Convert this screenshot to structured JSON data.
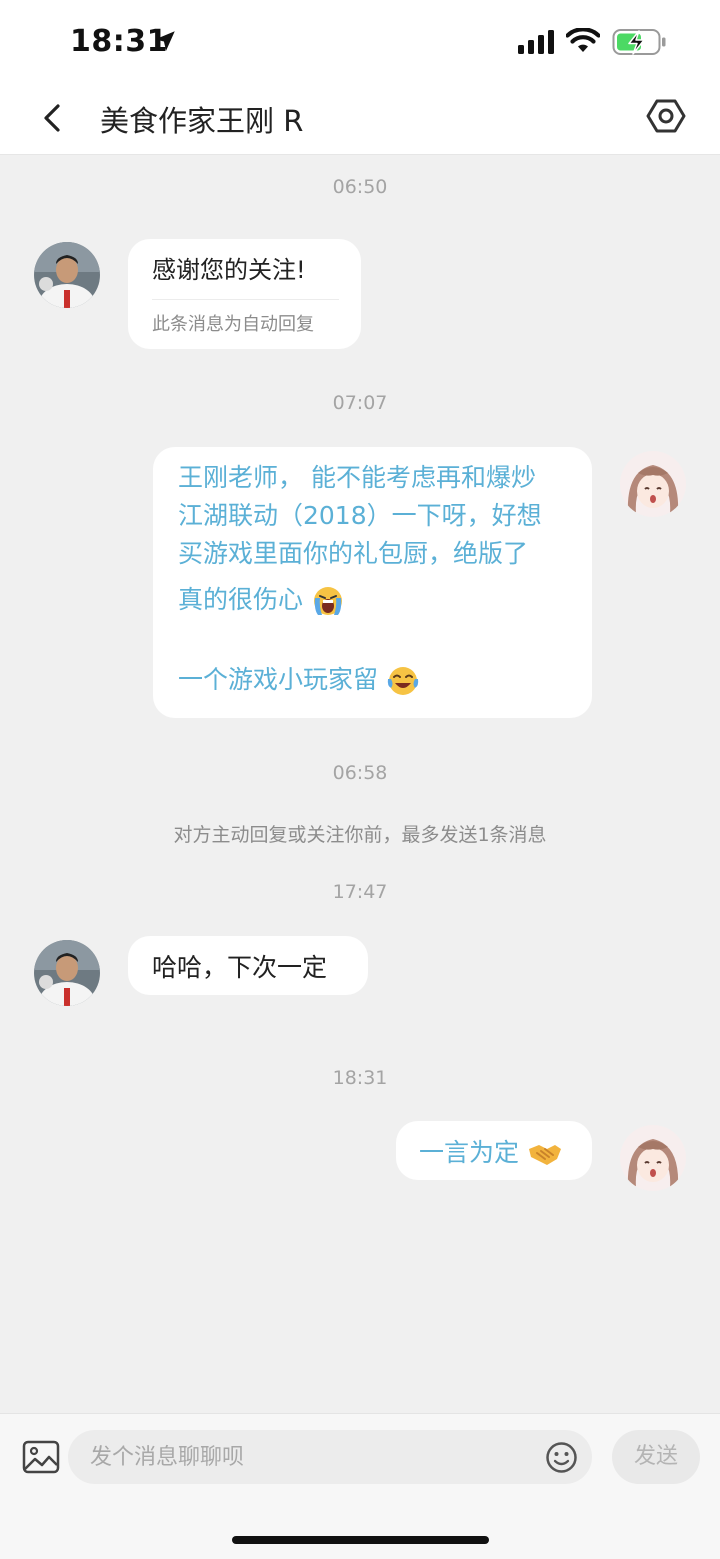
{
  "status": {
    "time": "18:31"
  },
  "nav": {
    "title": "美食作家王刚 R"
  },
  "messages": {
    "t1": "06:50",
    "m1_text": "感谢您的关注!",
    "m1_sub": "此条消息为自动回复",
    "t2": "07:07",
    "m2_line1": "王刚老师， 能不能考虑再和爆炒",
    "m2_line2": "江湖联动（2018）一下呀，好想",
    "m2_line3": "买游戏里面你的礼包厨，绝版了",
    "m2_line4": "真的很伤心",
    "m2_line6": "一个游戏小玩家留",
    "t3": "06:58",
    "notice": "对方主动回复或关注你前，最多发送1条消息",
    "t4": "17:47",
    "m3_text": "哈哈，下次一定",
    "t5": "18:31",
    "m4_text": "一言为定"
  },
  "composer": {
    "placeholder": "发个消息聊聊呗",
    "send_label": "发送"
  },
  "colors": {
    "my_text": "#5bb0d6",
    "background": "#f0f0f0",
    "bubble": "#ffffff"
  },
  "icons": [
    "location-arrow-icon",
    "signal-icon",
    "wifi-icon",
    "battery-charging-icon",
    "back-chevron-icon",
    "settings-hex-icon",
    "image-icon",
    "emoji-icon",
    "crying-emoji",
    "tears-of-joy-emoji",
    "handshake-emoji"
  ]
}
